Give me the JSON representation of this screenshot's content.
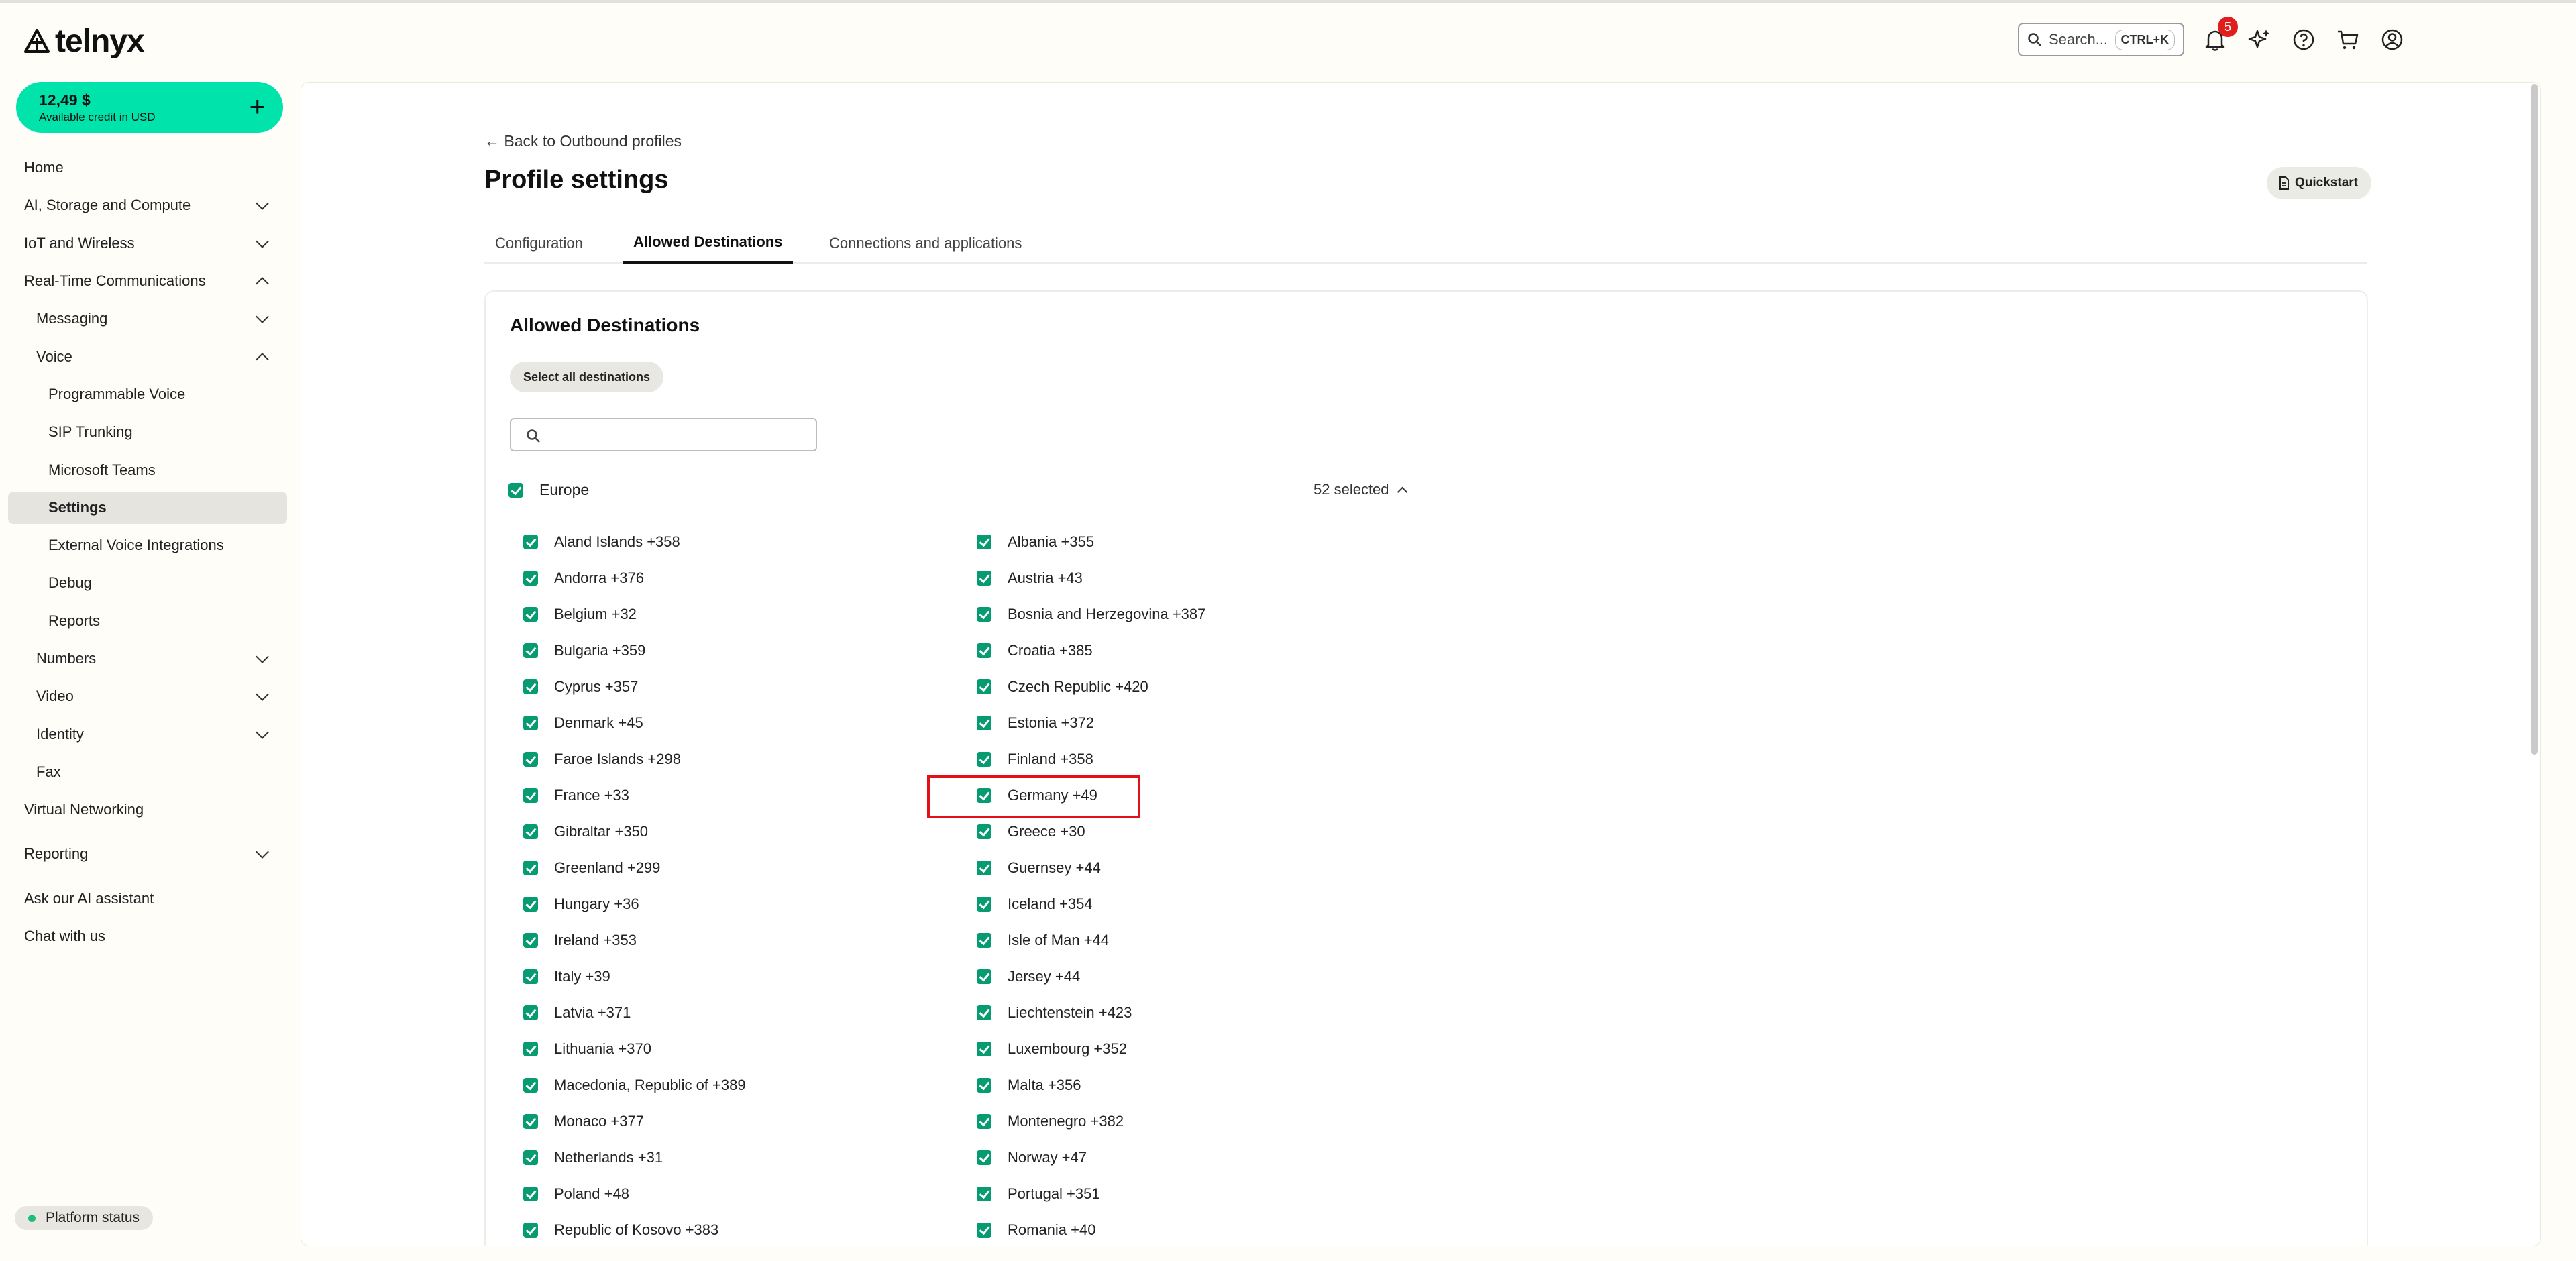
{
  "brand": {
    "name": "telnyx"
  },
  "header": {
    "search_label": "Search...",
    "search_shortcut": "CTRL+K",
    "notification_count": "5",
    "icons": [
      "search-icon",
      "bell-icon",
      "sparkle-icon",
      "help-icon",
      "cart-icon",
      "account-icon"
    ]
  },
  "credit": {
    "amount": "12,49 $",
    "label": "Available credit in USD"
  },
  "sidebar": {
    "items": [
      {
        "label": "Home"
      },
      {
        "label": "AI, Storage and Compute"
      },
      {
        "label": "IoT and Wireless"
      },
      {
        "label": "Real-Time Communications"
      },
      {
        "label": "Messaging"
      },
      {
        "label": "Voice"
      },
      {
        "label": "Programmable Voice"
      },
      {
        "label": "SIP Trunking"
      },
      {
        "label": "Microsoft Teams"
      },
      {
        "label": "Settings"
      },
      {
        "label": "External Voice Integrations"
      },
      {
        "label": "Debug"
      },
      {
        "label": "Reports"
      },
      {
        "label": "Numbers"
      },
      {
        "label": "Video"
      },
      {
        "label": "Identity"
      },
      {
        "label": "Fax"
      },
      {
        "label": "Virtual Networking"
      },
      {
        "label": "Reporting"
      },
      {
        "label": "Ask our AI assistant"
      },
      {
        "label": "Chat with us"
      }
    ],
    "platform_status": "Platform status"
  },
  "page": {
    "back_link": "Back to Outbound profiles",
    "title": "Profile settings",
    "quickstart": "Quickstart",
    "tabs": [
      {
        "label": "Configuration"
      },
      {
        "label": "Allowed Destinations"
      },
      {
        "label": "Connections and applications"
      }
    ]
  },
  "destinations": {
    "title": "Allowed Destinations",
    "select_all": "Select all destinations",
    "search_value": "",
    "region": "Europe",
    "selected_count": "52 selected",
    "countries": [
      "Aland Islands +358",
      "Albania +355",
      "Andorra +376",
      "Austria +43",
      "Belgium +32",
      "Bosnia and Herzegovina +387",
      "Bulgaria +359",
      "Croatia +385",
      "Cyprus +357",
      "Czech Republic +420",
      "Denmark +45",
      "Estonia +372",
      "Faroe Islands +298",
      "Finland +358",
      "France +33",
      "Germany +49",
      "Gibraltar +350",
      "Greece +30",
      "Greenland +299",
      "Guernsey +44",
      "Hungary +36",
      "Iceland +354",
      "Ireland +353",
      "Isle of Man +44",
      "Italy +39",
      "Jersey +44",
      "Latvia +371",
      "Liechtenstein +423",
      "Lithuania +370",
      "Luxembourg +352",
      "Macedonia, Republic of +389",
      "Malta +356",
      "Monaco +377",
      "Montenegro +382",
      "Netherlands +31",
      "Norway +47",
      "Poland +48",
      "Portugal +351",
      "Republic of Kosovo +383",
      "Romania +40"
    ]
  },
  "colors": {
    "accent": "#00e3aa",
    "checkbox": "#079b72",
    "highlight": "#e3101a",
    "badge": "#e11d1d"
  }
}
